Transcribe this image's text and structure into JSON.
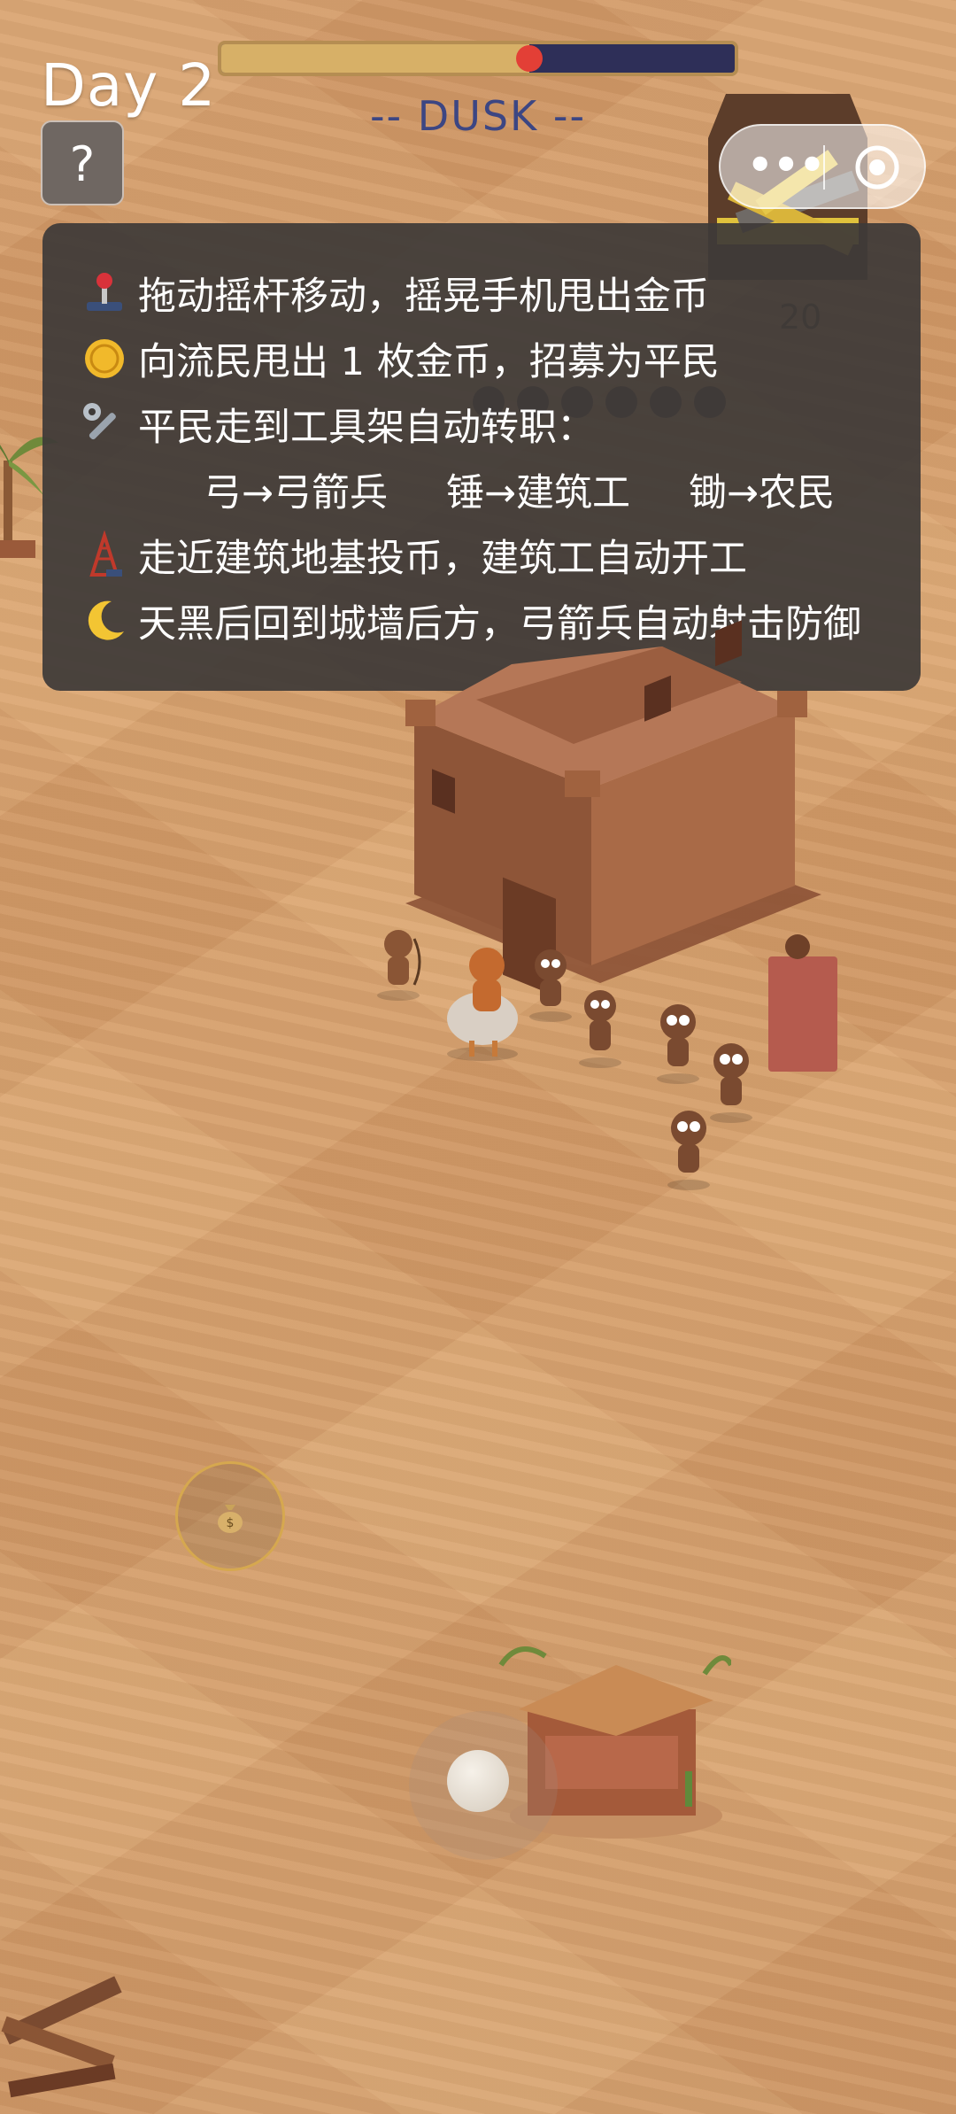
{
  "hud": {
    "day_label": "Day 2",
    "help_label": "?",
    "phase_label": "-- DUSK --",
    "day_progress": 0.6,
    "counter_value": "20"
  },
  "mini_program_capsule": {
    "menu_label": "•••"
  },
  "tutorial": {
    "lines": [
      {
        "icon": "joystick-icon",
        "text": "拖动摇杆移动，摇晃手机甩出金币"
      },
      {
        "icon": "coin-icon",
        "text": "向流民甩出 1 枚金币，招募为平民"
      },
      {
        "icon": "wrench-icon",
        "text": "平民走到工具架自动转职："
      },
      {
        "icon": "oil-derrick-icon",
        "text": "走近建筑地基投币，建筑工自动开工"
      },
      {
        "icon": "moon-icon",
        "text": "天黑后回到城墙后方，弓箭兵自动射击防御"
      }
    ],
    "job_mappings": [
      "弓→弓箭兵",
      "锤→建筑工",
      "锄→农民"
    ]
  },
  "controls": {
    "coin_button_icon": "money-bag-icon",
    "joystick": "joystick-knob"
  },
  "colors": {
    "sand": "#d7a06e",
    "panel": "#3e3a38",
    "bar_day": "#d7b067",
    "bar_night": "#2e2f58",
    "bar_marker": "#e33f36",
    "phase_text": "#3c4683"
  }
}
